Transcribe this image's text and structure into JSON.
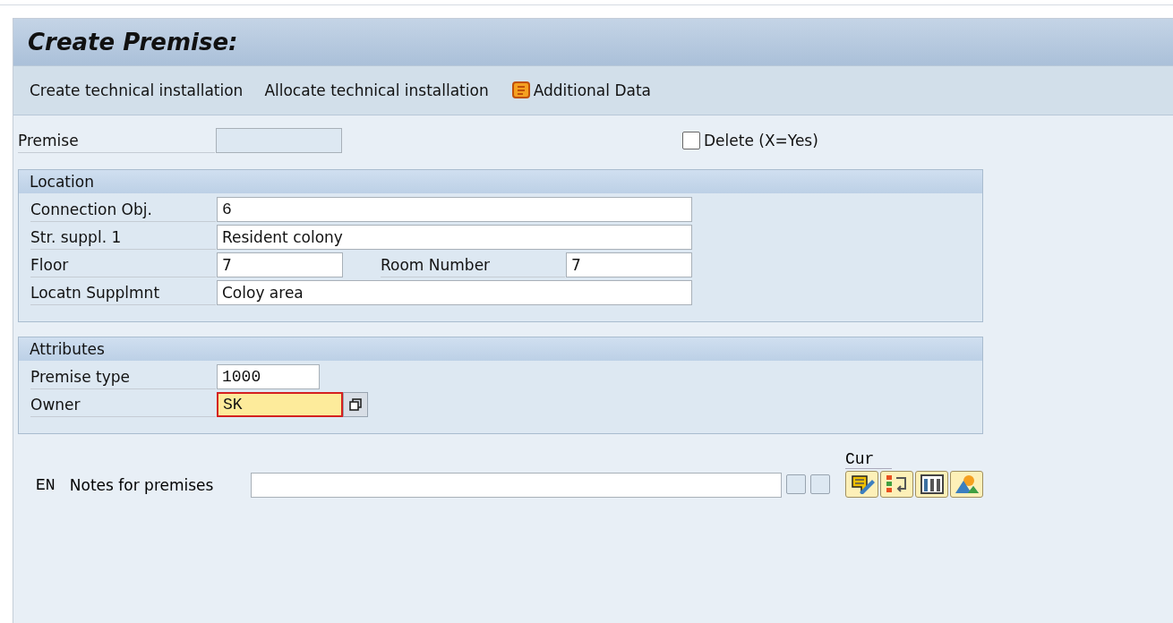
{
  "window": {
    "title": "Create Premise:"
  },
  "toolbar": [
    {
      "label": "Create technical installation",
      "kind": "text"
    },
    {
      "label": "Allocate technical installation",
      "kind": "text"
    },
    {
      "label": "Additional Data",
      "kind": "scroll"
    }
  ],
  "header": {
    "premise": {
      "label": "Premise",
      "disabled": true
    },
    "delete": {
      "label": "Delete (X=Yes)",
      "checked": false
    }
  },
  "groups": [
    {
      "title": "Location",
      "rows": [
        [
          {
            "label": "Connection Obj.",
            "value": "6",
            "kind": "longcode",
            "focused": false
          }
        ],
        [
          {
            "label": "Str. suppl. 1",
            "value": "Resident colony",
            "kind": "long",
            "focused": false
          }
        ],
        [
          {
            "label": "Floor",
            "value": "7",
            "kind": "short",
            "focused": false
          },
          {
            "label": "Room Number",
            "value": "7",
            "kind": "short",
            "focused": false
          }
        ],
        [
          {
            "label": "Locatn Supplmnt",
            "value": "Coloy area",
            "kind": "long",
            "focused": false
          }
        ]
      ]
    },
    {
      "title": "Attributes",
      "rows": [
        [
          {
            "label": "Premise type",
            "value": "1000",
            "kind": "code",
            "focused": false
          }
        ],
        [
          {
            "label": "Owner",
            "value": "SK",
            "kind": "shortcode",
            "focused": true,
            "value_help": true
          }
        ]
      ]
    }
  ],
  "notes": {
    "language": "EN",
    "label": "Notes for premises",
    "checks": [
      {
        "checked": false
      },
      {
        "checked": false
      }
    ],
    "column_label": "Cur",
    "buttons": [
      {
        "kind": "edit"
      },
      {
        "kind": "list"
      },
      {
        "kind": "columns"
      },
      {
        "kind": "picture"
      }
    ]
  }
}
